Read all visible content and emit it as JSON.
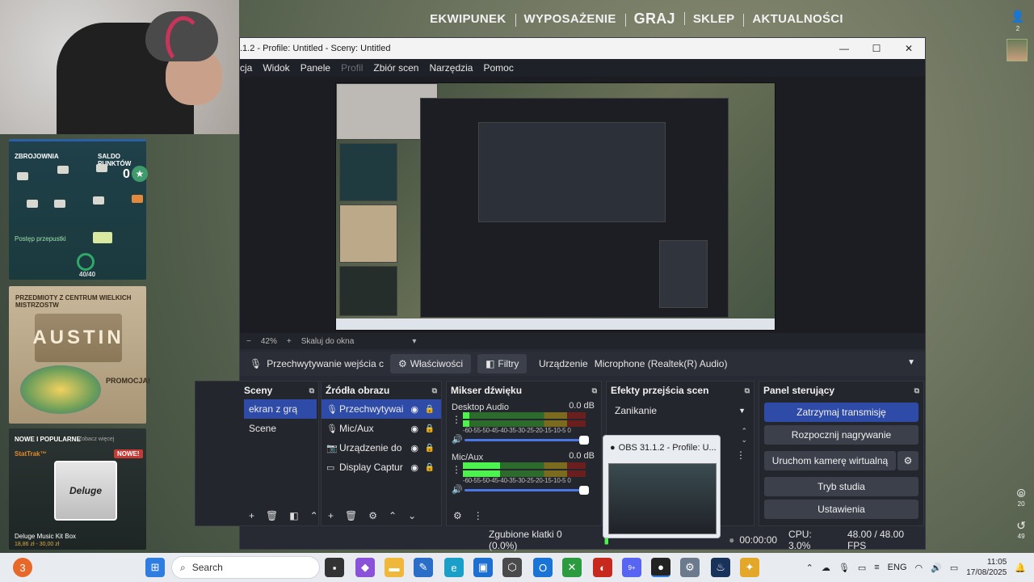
{
  "game": {
    "nav": [
      "EKWIPUNEK",
      "WYPOSAŻENIE",
      "GRAJ",
      "SKLEP",
      "AKTUALNOŚCI"
    ],
    "friends_count": "2",
    "armory_title": "ZBROJOWNIA",
    "points_title": "SALDO PUNKTÓW",
    "points_value": "0",
    "pass_progress": "Postęp przepustki",
    "pass_score": "40/40",
    "promo_title": "PRZEDMIOTY Z CENTRUM WIELKICH MISTRZOSTW",
    "promo_logo": "AUSTIN",
    "promo_badge": "PROMOCJA!",
    "new_title": "NOWE I POPULARNE",
    "new_more": "Zobacz więcej",
    "stattrak": "StatTrak™",
    "new_badge": "NOWE!",
    "box_label": "Deluge",
    "box_name": "Deluge Music Kit Box",
    "box_price": "18,86 zł - 30,00 zł",
    "side_count_1": "20",
    "side_count_2": "49"
  },
  "obs": {
    "title": ".1.2 - Profile: Untitled - Sceny: Untitled",
    "menu": [
      "cja",
      "Widok",
      "Panele",
      "Profil",
      "Zbiór scen",
      "Narzędzia",
      "Pomoc"
    ],
    "zoom": "42%",
    "zoom_minus": "−",
    "zoom_plus": "+",
    "zoom_mode": "Skaluj do okna",
    "source_name": "Przechwytywanie wejścia c",
    "properties": "Właściwości",
    "filters": "Filtry",
    "device_label": "Urządzenie",
    "device_value": "Microphone (Realtek(R) Audio)",
    "scenes": {
      "title": "Sceny",
      "items": [
        "ekran z grą",
        "Scene"
      ]
    },
    "sources": {
      "title": "Źródła obrazu",
      "items": [
        "Przechwytywai",
        "Mic/Aux",
        "Urządzenie do",
        "Display Captur"
      ]
    },
    "mixer": {
      "title": "Mikser dźwięku",
      "channels": [
        {
          "name": "Desktop Audio",
          "db": "0.0 dB",
          "level": 0.05
        },
        {
          "name": "Mic/Aux",
          "db": "0.0 dB",
          "level": 0.3
        }
      ],
      "scale": "-60-55-50-45-40-35-30-25-20-15-10-5 0"
    },
    "transitions": {
      "title": "Efekty przejścia scen",
      "value": "Zanikanie"
    },
    "controls": {
      "title": "Panel sterujący",
      "stop_stream": "Zatrzymaj transmisję",
      "start_recording": "Rozpocznij nagrywanie",
      "virtual_cam": "Uruchom kamerę wirtualną",
      "studio_mode": "Tryb studia",
      "settings": "Ustawienia"
    },
    "status": {
      "dropped": "Zgubione klatki 0 (0.0%)",
      "live_time": "00:00:00",
      "cpu": "CPU: 3.0%",
      "fps": "48.00 / 48.00 FPS"
    },
    "popup_title": "OBS 31.1.2 - Profile: U..."
  },
  "taskbar": {
    "search_placeholder": "Search",
    "badge_count": "3",
    "discord_badge": "9+",
    "lang": "ENG",
    "time": "11:05",
    "date": "17/08/2025"
  },
  "colors": {
    "accent": "#2e4ba8",
    "obs_bg": "#272a33",
    "taskbar": "#e8ebf0"
  }
}
